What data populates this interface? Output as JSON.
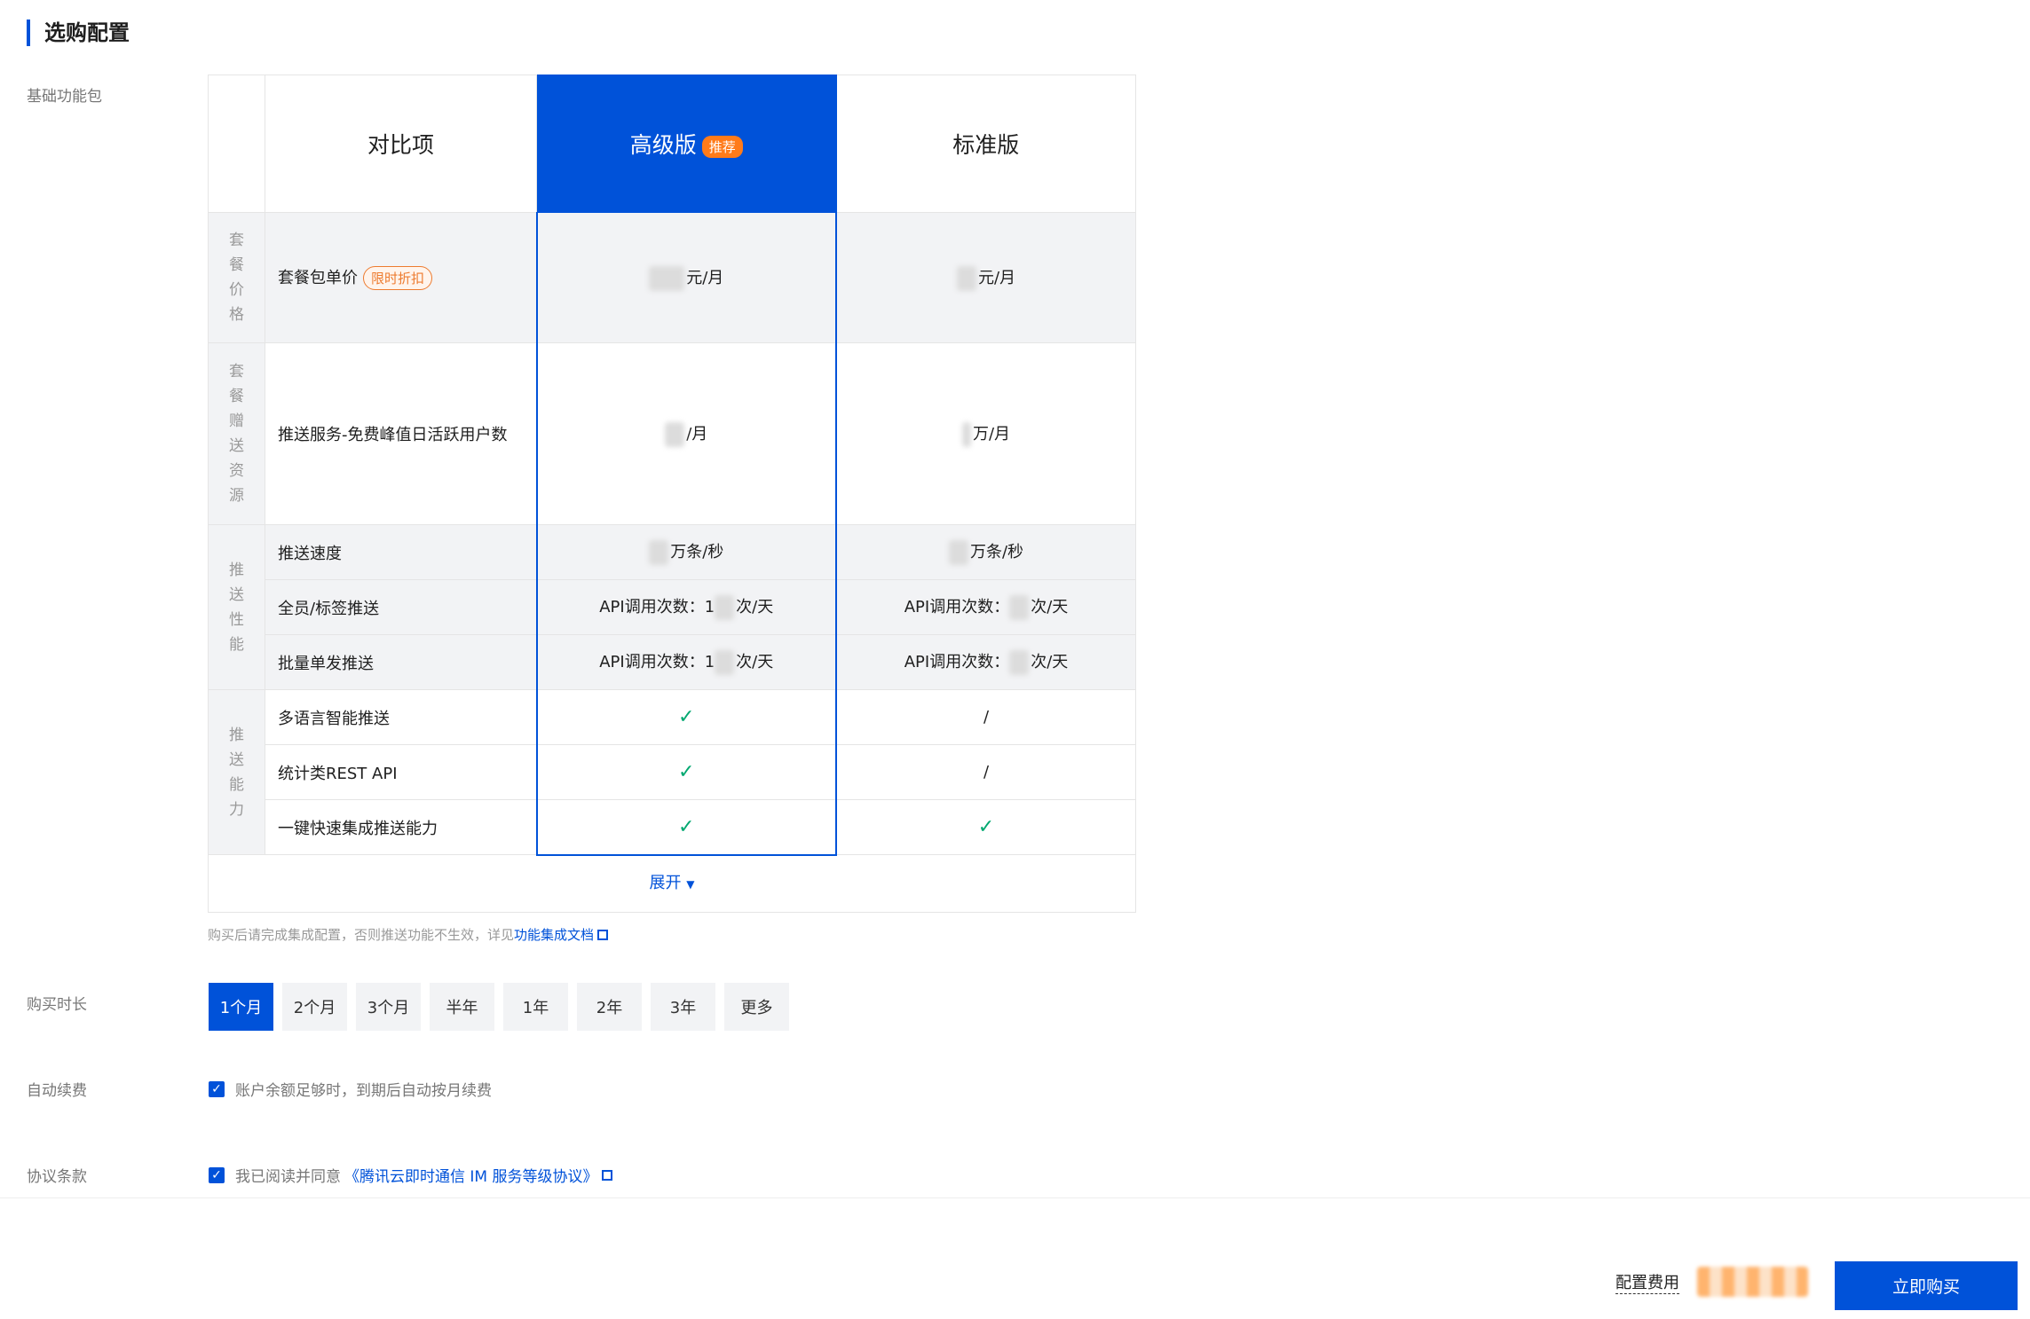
{
  "section_title": "选购配置",
  "labels": {
    "base_package": "基础功能包",
    "duration": "购买时长",
    "auto_renew": "自动续费",
    "agreement": "协议条款"
  },
  "table": {
    "header": {
      "compare": "对比项",
      "advanced": "高级版",
      "recommend_badge": "推荐",
      "standard": "标准版"
    },
    "categories": {
      "price": "套餐价格",
      "gift": "套餐赠送资源",
      "performance": "推送性能",
      "capability": "推送能力"
    },
    "rows": {
      "unit_price": {
        "label": "套餐包单价",
        "tag": "限时折扣",
        "advanced": "元/月",
        "standard": "元/月"
      },
      "dau": {
        "label": "推送服务-免费峰值日活跃用户数",
        "advanced": "/月",
        "standard": "万/月"
      },
      "speed": {
        "label": "推送速度",
        "advanced": "万条/秒",
        "standard": "万条/秒"
      },
      "all_tag": {
        "label": "全员/标签推送",
        "advanced_prefix": "API调用次数：1",
        "advanced_suffix": "次/天",
        "standard_prefix": "API调用次数：",
        "standard_suffix": "次/天"
      },
      "batch": {
        "label": "批量单发推送",
        "advanced_prefix": "API调用次数：1",
        "advanced_suffix": "次/天",
        "standard_prefix": "API调用次数：",
        "standard_suffix": "次/天"
      },
      "multilang": {
        "label": "多语言智能推送",
        "standard": "/"
      },
      "stats_api": {
        "label": "统计类REST API",
        "standard": "/"
      },
      "quick": {
        "label": "一键快速集成推送能力"
      }
    },
    "expand": "展开"
  },
  "note": {
    "text": "购买后请完成集成配置，否则推送功能不生效，详见",
    "link": "功能集成文档"
  },
  "durations": [
    "1个月",
    "2个月",
    "3个月",
    "半年",
    "1年",
    "2年",
    "3年",
    "更多"
  ],
  "selected_duration": "1个月",
  "auto_renew_text": "账户余额足够时，到期后自动按月续费",
  "agreement_text": "我已阅读并同意",
  "agreement_link": "《腾讯云即时通信 IM 服务等级协议》",
  "footer": {
    "cost_label": "配置费用",
    "buy_button": "立即购买"
  },
  "colors": {
    "primary": "#0052d9",
    "badge": "#ff7b1a",
    "check": "#00a870"
  }
}
